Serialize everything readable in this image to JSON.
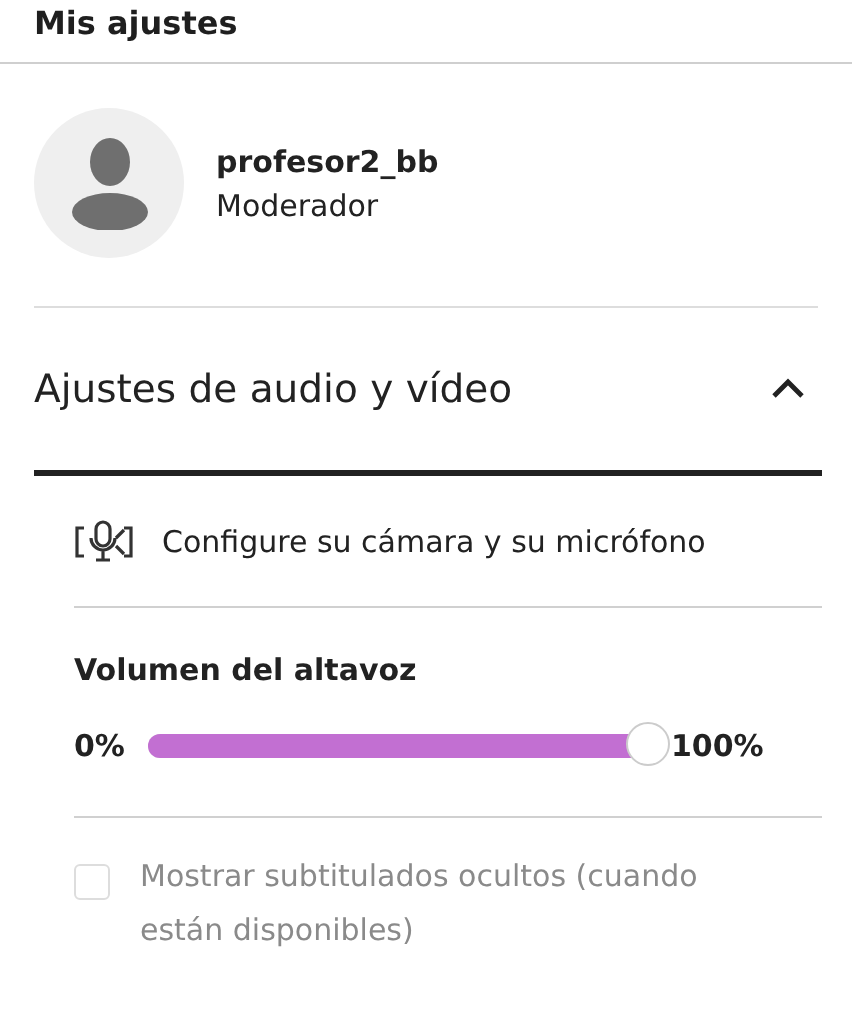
{
  "header": {
    "title": "Mis ajustes"
  },
  "user": {
    "name": "profesor2_bb",
    "role": "Moderador"
  },
  "section": {
    "title": "Ajustes de audio y vídeo",
    "expanded": true,
    "setup_link": "Configure su cámara y su micrófono",
    "volume": {
      "label": "Volumen del altavoz",
      "min_label": "0%",
      "max_label": "100%",
      "level": 1.0
    },
    "captions": {
      "label": "Mostrar subtitulados ocultos (cuando están disponibles)",
      "checked": false,
      "disabled": true
    }
  }
}
